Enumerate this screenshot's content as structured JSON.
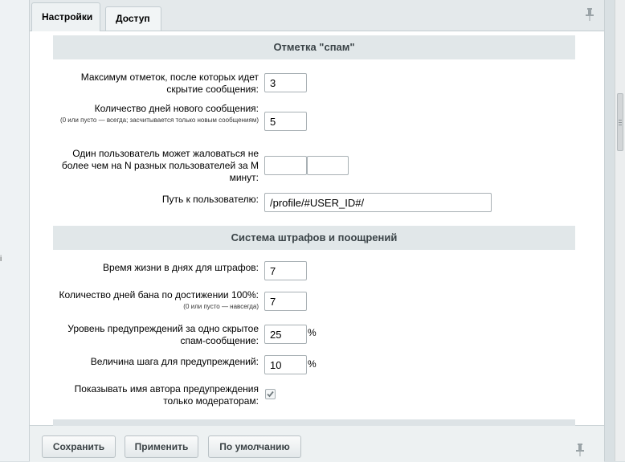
{
  "tabs": [
    {
      "label": "Настройки",
      "active": true
    },
    {
      "label": "Доступ",
      "active": false
    }
  ],
  "spam_section": {
    "title": "Отметка \"спам\"",
    "max_marks": {
      "label": "Максимум отметок, после которых идет скрытие сообщения:",
      "value": "3"
    },
    "new_msg_days": {
      "label": "Количество дней нового сообщения:",
      "hint": "(0 или пусто — всегда; засчитывается только новым сообщениям)",
      "value": "5"
    },
    "rate_limit": {
      "label": "Один пользователь может жаловаться не более чем на N разных пользователей за M минут:",
      "n_value": "",
      "m_value": ""
    },
    "user_path": {
      "label": "Путь к пользователю:",
      "value": "/profile/#USER_ID#/"
    }
  },
  "penalty_section": {
    "title": "Система штрафов и поощрений",
    "penalty_lifetime": {
      "label": "Время жизни в днях для штрафов:",
      "value": "7"
    },
    "ban_days": {
      "label": "Количество дней бана по достижении 100%:",
      "hint": "(0 или пусто — навсегда)",
      "value": "7"
    },
    "warning_level": {
      "label": "Уровень предупреждений за одно скрытое спам-сообщение:",
      "value": "25",
      "unit": "%"
    },
    "warning_step": {
      "label": "Величина шага для предупреждений:",
      "value": "10",
      "unit": "%"
    },
    "show_author": {
      "label": "Показывать имя автора предупреждения только модераторам:",
      "checked": true
    }
  },
  "buttons": {
    "save": "Сохранить",
    "apply": "Применить",
    "defaults": "По умолчанию"
  },
  "icons": [
    "pin-icon",
    "check-icon"
  ]
}
